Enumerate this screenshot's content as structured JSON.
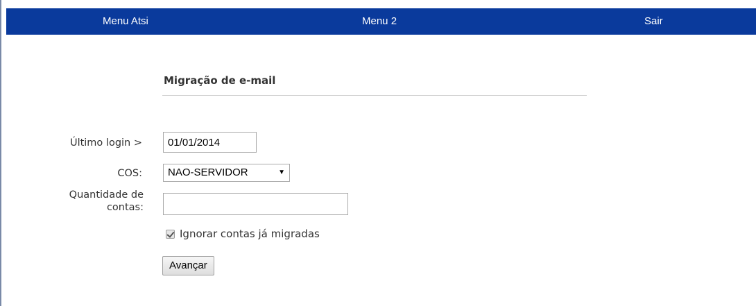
{
  "nav": {
    "items": [
      {
        "label": "Menu Atsi"
      },
      {
        "label": "Menu 2"
      },
      {
        "label": "Sair"
      }
    ]
  },
  "form": {
    "title": "Migração de e-mail",
    "last_login_label": "Último login >",
    "last_login_value": "01/01/2014",
    "cos_label": "COS:",
    "cos_selected": "NAO-SERVIDOR",
    "quantity_label_line1": "Quantidade de",
    "quantity_label_line2": "contas:",
    "quantity_value": "",
    "ignore_label": "Ignorar contas já migradas",
    "ignore_checked": true,
    "submit_label": "Avançar"
  },
  "colors": {
    "nav_background": "#0a3a9c",
    "nav_text": "#ffffff"
  }
}
